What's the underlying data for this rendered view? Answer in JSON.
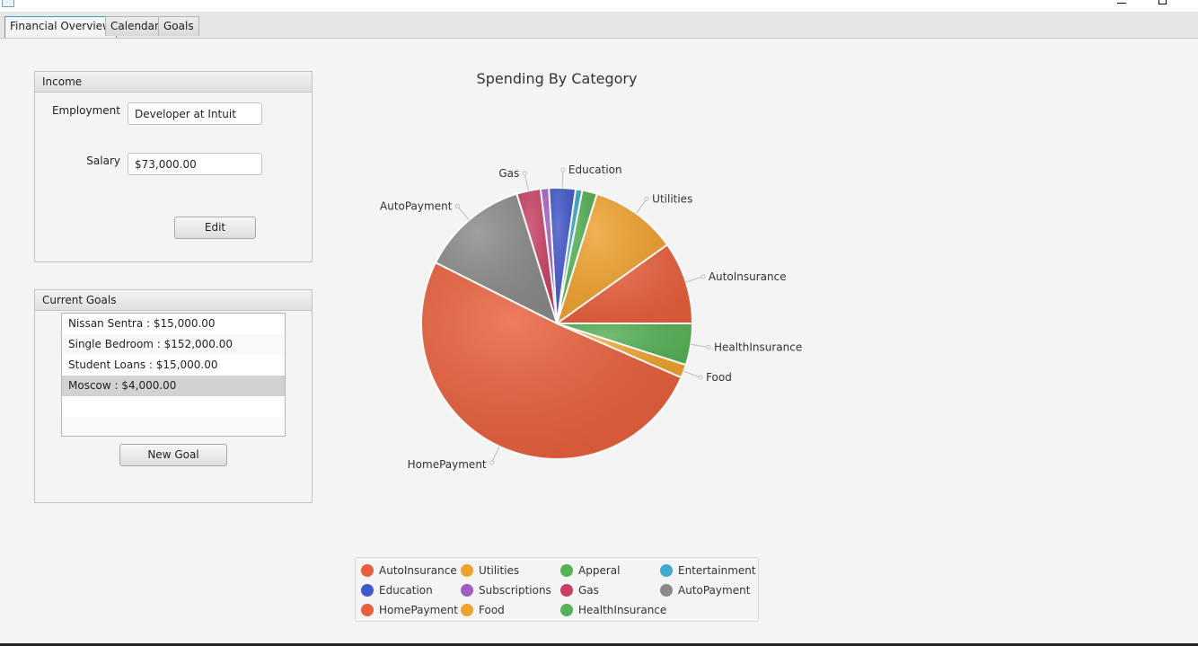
{
  "tabs": [
    "Financial Overview",
    "Calendar",
    "Goals"
  ],
  "income": {
    "header": "Income",
    "employment_label": "Employment",
    "employment_value": "Developer at Intuit",
    "salary_label": "Salary",
    "salary_value": "$73,000.00",
    "edit_label": "Edit"
  },
  "goals": {
    "header": "Current Goals",
    "items": [
      "Nissan Sentra : $15,000.00",
      "Single Bedroom : $152,000.00",
      "Student Loans : $15,000.00",
      "Moscow : $4,000.00"
    ],
    "selected_index": 3,
    "new_goal_label": "New Goal"
  },
  "chart_data": {
    "type": "pie",
    "title": "Spending By Category",
    "slices": [
      {
        "name": "AutoInsurance",
        "value": 10.0,
        "color": "#e8603c"
      },
      {
        "name": "Utilities",
        "value": 10.5,
        "color": "#f0a22e"
      },
      {
        "name": "Apperal",
        "value": 1.8,
        "color": "#57b157"
      },
      {
        "name": "Entertainment",
        "value": 0.8,
        "color": "#41a9c9"
      },
      {
        "name": "Education",
        "value": 3.2,
        "color": "#4258c9"
      },
      {
        "name": "Subscriptions",
        "value": 1.0,
        "color": "#a35cc4"
      },
      {
        "name": "Gas",
        "value": 2.9,
        "color": "#c84164"
      },
      {
        "name": "AutoPayment",
        "value": 13.0,
        "color": "#8a8a8a"
      },
      {
        "name": "HomePayment",
        "value": 51.6,
        "color": "#e8603c"
      },
      {
        "name": "Food",
        "value": 1.6,
        "color": "#f0a22e"
      },
      {
        "name": "HealthInsurance",
        "value": 5.0,
        "color": "#57b157"
      }
    ],
    "outer_labels": [
      "AutoInsurance",
      "Utilities",
      "Education",
      "Gas",
      "AutoPayment",
      "HomePayment",
      "Food",
      "HealthInsurance"
    ],
    "legend": [
      "AutoInsurance",
      "Utilities",
      "Apperal",
      "Entertainment",
      "Education",
      "Subscriptions",
      "Gas",
      "AutoPayment",
      "HomePayment",
      "Food",
      "HealthInsurance"
    ],
    "legend_placement": "bottom"
  }
}
